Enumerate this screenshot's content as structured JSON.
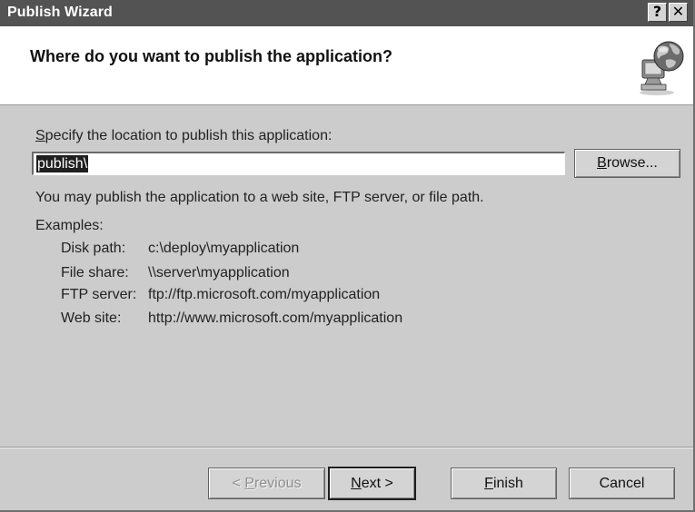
{
  "window": {
    "title": "Publish Wizard",
    "help_glyph": "?",
    "close_glyph": "✕"
  },
  "header": {
    "title": "Where do you want to publish the application?",
    "icon": "globe-computer-icon"
  },
  "location": {
    "label_first": "S",
    "label_rest": "pecify the location to publish this application:",
    "value": "publish\\",
    "browse_accel": "B",
    "browse_rest": "rowse..."
  },
  "info": {
    "description": "You may publish the application to a web site, FTP server, or file path.",
    "examples_label": "Examples:",
    "examples": [
      {
        "type": "Disk path:",
        "value": "c:\\deploy\\myapplication"
      },
      {
        "type": "File share:",
        "value": "\\\\server\\myapplication"
      },
      {
        "type": "FTP server:",
        "value": "ftp://ftp.microsoft.com/myapplication"
      },
      {
        "type": "Web site:",
        "value": "http://www.microsoft.com/myapplication"
      }
    ]
  },
  "buttons": {
    "previous_prefix": "< ",
    "previous_accel": "P",
    "previous_rest": "revious",
    "next_accel": "N",
    "next_rest": "ext >",
    "finish_accel": "F",
    "finish_rest": "inish",
    "cancel": "Cancel"
  }
}
